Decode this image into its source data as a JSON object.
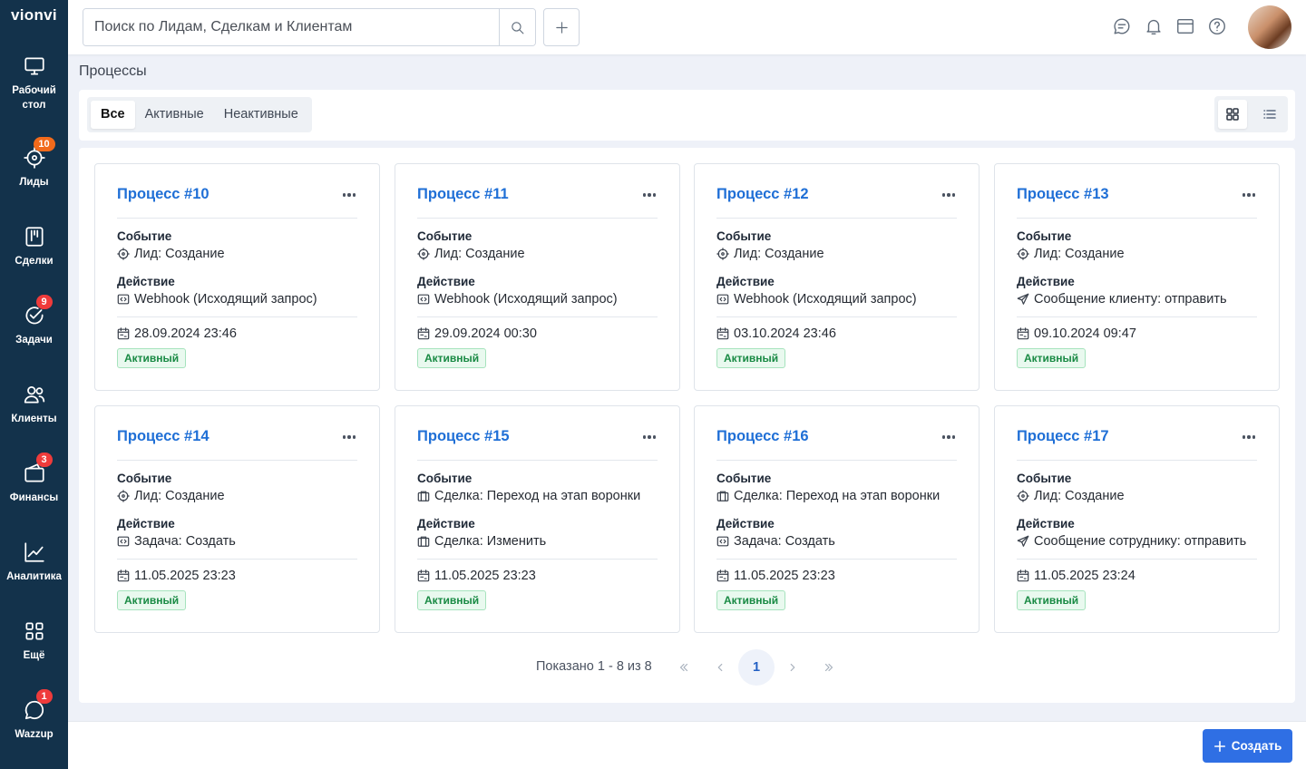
{
  "app": {
    "logo": "vionvi"
  },
  "sidebar": {
    "items": [
      {
        "label": "Рабочий стол",
        "icon": "monitor-icon",
        "badge": ""
      },
      {
        "label": "Лиды",
        "icon": "target-icon",
        "badge": "10"
      },
      {
        "label": "Сделки",
        "icon": "kanban-icon",
        "badge": ""
      },
      {
        "label": "Задачи",
        "icon": "check-circle-icon",
        "badge": "9"
      },
      {
        "label": "Клиенты",
        "icon": "users-icon",
        "badge": ""
      },
      {
        "label": "Финансы",
        "icon": "wallet-icon",
        "badge": "3"
      },
      {
        "label": "Аналитика",
        "icon": "chart-icon",
        "badge": ""
      },
      {
        "label": "Ещё",
        "icon": "grid-icon",
        "badge": ""
      },
      {
        "label": "Wazzup",
        "icon": "chat-bubble-icon",
        "badge": "1"
      }
    ]
  },
  "header": {
    "search_placeholder": "Поиск по Лидам, Сделкам и Клиентам",
    "icons": [
      "chat-icon",
      "bell-icon",
      "calendar-window-icon",
      "help-icon"
    ]
  },
  "page": {
    "title": "Процессы",
    "filters": [
      "Все",
      "Активные",
      "Неактивные"
    ],
    "active_filter": "Все",
    "view": "grid"
  },
  "labels": {
    "event": "Событие",
    "action": "Действие"
  },
  "processes": [
    {
      "title": "Процесс #10",
      "event": "Лид: Создание",
      "event_icon": "lead",
      "action": "Webhook (Исходящий запрос)",
      "action_icon": "code",
      "date": "28.09.2024 23:46",
      "status": "Активный"
    },
    {
      "title": "Процесс #11",
      "event": "Лид: Создание",
      "event_icon": "lead",
      "action": "Webhook (Исходящий запрос)",
      "action_icon": "code",
      "date": "29.09.2024 00:30",
      "status": "Активный"
    },
    {
      "title": "Процесс #12",
      "event": "Лид: Создание",
      "event_icon": "lead",
      "action": "Webhook (Исходящий запрос)",
      "action_icon": "code",
      "date": "03.10.2024 23:46",
      "status": "Активный"
    },
    {
      "title": "Процесс #13",
      "event": "Лид: Создание",
      "event_icon": "lead",
      "action": "Сообщение клиенту: отправить",
      "action_icon": "send",
      "date": "09.10.2024 09:47",
      "status": "Активный"
    },
    {
      "title": "Процесс #14",
      "event": "Лид: Создание",
      "event_icon": "lead",
      "action": "Задача: Создать",
      "action_icon": "code",
      "date": "11.05.2025 23:23",
      "status": "Активный"
    },
    {
      "title": "Процесс #15",
      "event": "Сделка: Переход на этап воронки",
      "event_icon": "deal",
      "action": "Сделка: Изменить",
      "action_icon": "deal",
      "date": "11.05.2025 23:23",
      "status": "Активный"
    },
    {
      "title": "Процесс #16",
      "event": "Сделка: Переход на этап воронки",
      "event_icon": "deal",
      "action": "Задача: Создать",
      "action_icon": "code",
      "date": "11.05.2025 23:23",
      "status": "Активный"
    },
    {
      "title": "Процесс #17",
      "event": "Лид: Создание",
      "event_icon": "lead",
      "action": "Сообщение сотруднику: отправить",
      "action_icon": "send",
      "date": "11.05.2025 23:24",
      "status": "Активный"
    }
  ],
  "pagination": {
    "info": "Показано 1 - 8 из 8",
    "current_page": "1"
  },
  "footer": {
    "create_label": "Создать"
  },
  "colors": {
    "sidebar": "#13324b",
    "accent": "#2f6fe4",
    "link": "#1f6fd6",
    "status_green": "#198a44"
  }
}
